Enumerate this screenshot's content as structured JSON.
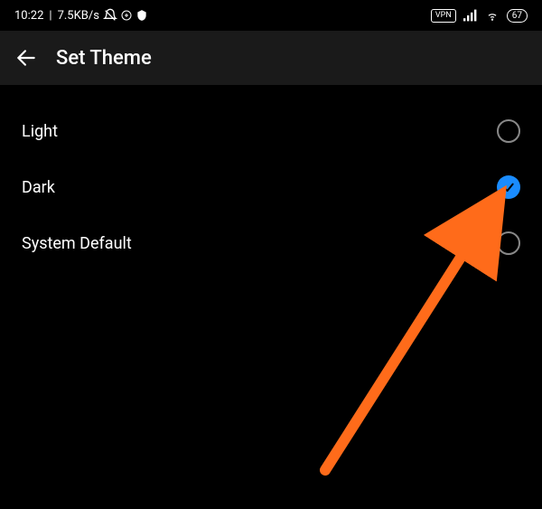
{
  "statusBar": {
    "time": "10:22",
    "speed": "7.5KB/s",
    "vpnLabel": "VPN",
    "batteryLevel": "67"
  },
  "header": {
    "title": "Set Theme"
  },
  "options": [
    {
      "label": "Light",
      "selected": false
    },
    {
      "label": "Dark",
      "selected": true
    },
    {
      "label": "System Default",
      "selected": false
    }
  ],
  "annotation": {
    "arrowColor": "#ff6b1a"
  }
}
